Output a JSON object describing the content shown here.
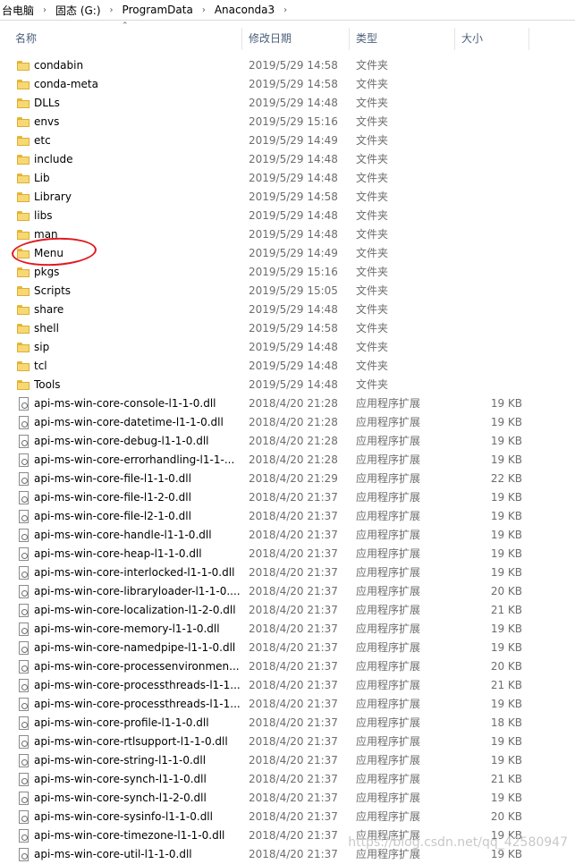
{
  "breadcrumb": [
    "台电脑",
    "固态 (G:)",
    "ProgramData",
    "Anaconda3"
  ],
  "columns": {
    "name": "名称",
    "date": "修改日期",
    "type": "类型",
    "size": "大小"
  },
  "rows": [
    {
      "name": "condabin",
      "date": "2019/5/29 14:58",
      "type": "文件夹",
      "size": "",
      "kind": "folder"
    },
    {
      "name": "conda-meta",
      "date": "2019/5/29 14:58",
      "type": "文件夹",
      "size": "",
      "kind": "folder"
    },
    {
      "name": "DLLs",
      "date": "2019/5/29 14:48",
      "type": "文件夹",
      "size": "",
      "kind": "folder"
    },
    {
      "name": "envs",
      "date": "2019/5/29 15:16",
      "type": "文件夹",
      "size": "",
      "kind": "folder"
    },
    {
      "name": "etc",
      "date": "2019/5/29 14:49",
      "type": "文件夹",
      "size": "",
      "kind": "folder"
    },
    {
      "name": "include",
      "date": "2019/5/29 14:48",
      "type": "文件夹",
      "size": "",
      "kind": "folder"
    },
    {
      "name": "Lib",
      "date": "2019/5/29 14:48",
      "type": "文件夹",
      "size": "",
      "kind": "folder"
    },
    {
      "name": "Library",
      "date": "2019/5/29 14:58",
      "type": "文件夹",
      "size": "",
      "kind": "folder"
    },
    {
      "name": "libs",
      "date": "2019/5/29 14:48",
      "type": "文件夹",
      "size": "",
      "kind": "folder"
    },
    {
      "name": "man",
      "date": "2019/5/29 14:48",
      "type": "文件夹",
      "size": "",
      "kind": "folder"
    },
    {
      "name": "Menu",
      "date": "2019/5/29 14:49",
      "type": "文件夹",
      "size": "",
      "kind": "folder"
    },
    {
      "name": "pkgs",
      "date": "2019/5/29 15:16",
      "type": "文件夹",
      "size": "",
      "kind": "folder"
    },
    {
      "name": "Scripts",
      "date": "2019/5/29 15:05",
      "type": "文件夹",
      "size": "",
      "kind": "folder"
    },
    {
      "name": "share",
      "date": "2019/5/29 14:48",
      "type": "文件夹",
      "size": "",
      "kind": "folder"
    },
    {
      "name": "shell",
      "date": "2019/5/29 14:58",
      "type": "文件夹",
      "size": "",
      "kind": "folder"
    },
    {
      "name": "sip",
      "date": "2019/5/29 14:48",
      "type": "文件夹",
      "size": "",
      "kind": "folder"
    },
    {
      "name": "tcl",
      "date": "2019/5/29 14:48",
      "type": "文件夹",
      "size": "",
      "kind": "folder"
    },
    {
      "name": "Tools",
      "date": "2019/5/29 14:48",
      "type": "文件夹",
      "size": "",
      "kind": "folder"
    },
    {
      "name": "api-ms-win-core-console-l1-1-0.dll",
      "date": "2018/4/20 21:28",
      "type": "应用程序扩展",
      "size": "19 KB",
      "kind": "file"
    },
    {
      "name": "api-ms-win-core-datetime-l1-1-0.dll",
      "date": "2018/4/20 21:28",
      "type": "应用程序扩展",
      "size": "19 KB",
      "kind": "file"
    },
    {
      "name": "api-ms-win-core-debug-l1-1-0.dll",
      "date": "2018/4/20 21:28",
      "type": "应用程序扩展",
      "size": "19 KB",
      "kind": "file"
    },
    {
      "name": "api-ms-win-core-errorhandling-l1-1-...",
      "date": "2018/4/20 21:28",
      "type": "应用程序扩展",
      "size": "19 KB",
      "kind": "file"
    },
    {
      "name": "api-ms-win-core-file-l1-1-0.dll",
      "date": "2018/4/20 21:29",
      "type": "应用程序扩展",
      "size": "22 KB",
      "kind": "file"
    },
    {
      "name": "api-ms-win-core-file-l1-2-0.dll",
      "date": "2018/4/20 21:37",
      "type": "应用程序扩展",
      "size": "19 KB",
      "kind": "file"
    },
    {
      "name": "api-ms-win-core-file-l2-1-0.dll",
      "date": "2018/4/20 21:37",
      "type": "应用程序扩展",
      "size": "19 KB",
      "kind": "file"
    },
    {
      "name": "api-ms-win-core-handle-l1-1-0.dll",
      "date": "2018/4/20 21:37",
      "type": "应用程序扩展",
      "size": "19 KB",
      "kind": "file"
    },
    {
      "name": "api-ms-win-core-heap-l1-1-0.dll",
      "date": "2018/4/20 21:37",
      "type": "应用程序扩展",
      "size": "19 KB",
      "kind": "file"
    },
    {
      "name": "api-ms-win-core-interlocked-l1-1-0.dll",
      "date": "2018/4/20 21:37",
      "type": "应用程序扩展",
      "size": "19 KB",
      "kind": "file"
    },
    {
      "name": "api-ms-win-core-libraryloader-l1-1-0....",
      "date": "2018/4/20 21:37",
      "type": "应用程序扩展",
      "size": "20 KB",
      "kind": "file"
    },
    {
      "name": "api-ms-win-core-localization-l1-2-0.dll",
      "date": "2018/4/20 21:37",
      "type": "应用程序扩展",
      "size": "21 KB",
      "kind": "file"
    },
    {
      "name": "api-ms-win-core-memory-l1-1-0.dll",
      "date": "2018/4/20 21:37",
      "type": "应用程序扩展",
      "size": "19 KB",
      "kind": "file"
    },
    {
      "name": "api-ms-win-core-namedpipe-l1-1-0.dll",
      "date": "2018/4/20 21:37",
      "type": "应用程序扩展",
      "size": "19 KB",
      "kind": "file"
    },
    {
      "name": "api-ms-win-core-processenvironmen...",
      "date": "2018/4/20 21:37",
      "type": "应用程序扩展",
      "size": "20 KB",
      "kind": "file"
    },
    {
      "name": "api-ms-win-core-processthreads-l1-1...",
      "date": "2018/4/20 21:37",
      "type": "应用程序扩展",
      "size": "21 KB",
      "kind": "file"
    },
    {
      "name": "api-ms-win-core-processthreads-l1-1...",
      "date": "2018/4/20 21:37",
      "type": "应用程序扩展",
      "size": "19 KB",
      "kind": "file"
    },
    {
      "name": "api-ms-win-core-profile-l1-1-0.dll",
      "date": "2018/4/20 21:37",
      "type": "应用程序扩展",
      "size": "18 KB",
      "kind": "file"
    },
    {
      "name": "api-ms-win-core-rtlsupport-l1-1-0.dll",
      "date": "2018/4/20 21:37",
      "type": "应用程序扩展",
      "size": "19 KB",
      "kind": "file"
    },
    {
      "name": "api-ms-win-core-string-l1-1-0.dll",
      "date": "2018/4/20 21:37",
      "type": "应用程序扩展",
      "size": "19 KB",
      "kind": "file"
    },
    {
      "name": "api-ms-win-core-synch-l1-1-0.dll",
      "date": "2018/4/20 21:37",
      "type": "应用程序扩展",
      "size": "21 KB",
      "kind": "file"
    },
    {
      "name": "api-ms-win-core-synch-l1-2-0.dll",
      "date": "2018/4/20 21:37",
      "type": "应用程序扩展",
      "size": "19 KB",
      "kind": "file"
    },
    {
      "name": "api-ms-win-core-sysinfo-l1-1-0.dll",
      "date": "2018/4/20 21:37",
      "type": "应用程序扩展",
      "size": "20 KB",
      "kind": "file"
    },
    {
      "name": "api-ms-win-core-timezone-l1-1-0.dll",
      "date": "2018/4/20 21:37",
      "type": "应用程序扩展",
      "size": "19 KB",
      "kind": "file"
    },
    {
      "name": "api-ms-win-core-util-l1-1-0.dll",
      "date": "2018/4/20 21:37",
      "type": "应用程序扩展",
      "size": "19 KB",
      "kind": "file"
    }
  ],
  "watermark": "https://blog.csdn.net/qq_42580947",
  "colors": {
    "annotation": "#e0191f",
    "header_text": "#4c607a",
    "folder": "#f8d874"
  }
}
